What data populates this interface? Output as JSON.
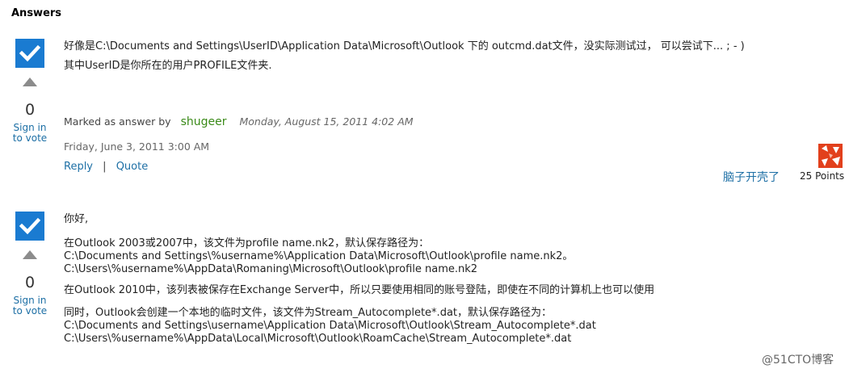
{
  "heading": "Answers",
  "answers": [
    {
      "votes": "0",
      "sign_in_line1": "Sign in",
      "sign_in_line2": "to vote",
      "body": [
        "好像是C:\\Documents and Settings\\UserID\\Application Data\\Microsoft\\Outlook 下的 outcmd.dat文件，没实际测试过， 可以尝试下... ; - )",
        "其中UserID是你所在的用户PROFILE文件夹."
      ],
      "marked_label": "Marked as answer by",
      "marked_by": "shugeer",
      "marked_date": "Monday, August 15, 2011 4:02 AM",
      "post_date": "Friday, June 3, 2011 3:00 AM",
      "reply_label": "Reply",
      "separator": "|",
      "quote_label": "Quote",
      "author": "脑子开壳了",
      "points": "25 Points"
    },
    {
      "votes": "0",
      "sign_in_line1": "Sign in",
      "sign_in_line2": "to vote",
      "body": [
        "你好,",
        "在Outlook 2003或2007中，该文件为profile name.nk2，默认保存路径为：",
        "C:\\Documents and Settings\\%username%\\Application Data\\Microsoft\\Outlook\\profile name.nk2。",
        "C:\\Users\\%username%\\AppData\\Romaning\\Microsoft\\Outlook\\profile name.nk2",
        "在Outlook 2010中，该列表被保存在Exchange Server中，所以只要使用相同的账号登陆，即使在不同的计算机上也可以使用",
        "同时，Outlook会创建一个本地的临时文件，该文件为Stream_Autocomplete*.dat，默认保存路径为：",
        "C:\\Documents and Settings\\username\\Application Data\\Microsoft\\Outlook\\Stream_Autocomplete*.dat",
        "C:\\Users\\%username%\\AppData\\Local\\Microsoft\\Outlook\\RoamCache\\Stream_Autocomplete*.dat"
      ]
    }
  ],
  "watermark": "@51CTO博客",
  "colors": {
    "accent_blue": "#1a7bd1",
    "link": "#1d6fa5",
    "user_green": "#3a8a18",
    "avatar": "#e2401c"
  },
  "icons": [
    "checkmark-icon",
    "up-arrow-icon",
    "avatar-icon"
  ]
}
